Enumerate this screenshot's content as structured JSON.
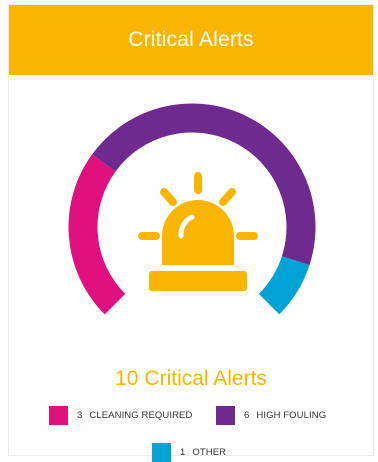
{
  "header": {
    "title": "Critical Alerts"
  },
  "summary": {
    "count": "10",
    "label": "Critical Alerts"
  },
  "colors": {
    "accent": "#f9b500",
    "cleaning": "#e0117f",
    "fouling": "#6e2a8e",
    "other": "#00a3d4"
  },
  "gauge": {
    "icon": "siren-icon",
    "segments": [
      {
        "key": "cleaning",
        "count": 3
      },
      {
        "key": "fouling",
        "count": 6
      },
      {
        "key": "other",
        "count": 1
      }
    ]
  },
  "legend": [
    {
      "count": "3",
      "label": "CLEANING REQUIRED",
      "color": "#e0117f"
    },
    {
      "count": "6",
      "label": "HIGH FOULING",
      "color": "#6e2a8e"
    },
    {
      "count": "1",
      "label": "OTHER",
      "color": "#00a3d4"
    }
  ]
}
